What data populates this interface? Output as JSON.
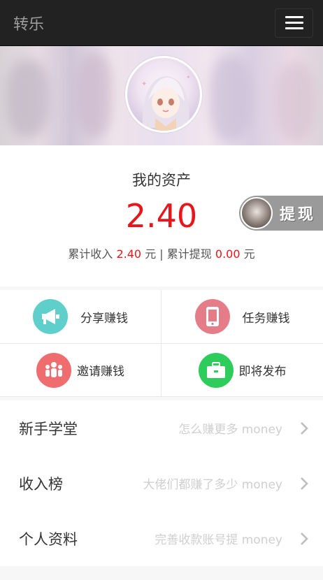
{
  "header": {
    "brand": "转乐",
    "menu_icon": "hamburger-icon"
  },
  "banner": {
    "avatar_icon": "anime-avatar"
  },
  "assets": {
    "title": "我的资产",
    "amount": "2.40",
    "income_label": "累计收入",
    "income_value": "2.40",
    "unit1": "元",
    "separator": "|",
    "withdrawn_label": "累计提现",
    "withdrawn_value": "0.00",
    "unit2": "元"
  },
  "withdraw_button": {
    "label": "提现",
    "avatar_icon": "anime-avatar-small"
  },
  "actions": [
    {
      "label": "分享赚钱",
      "icon": "megaphone-icon",
      "color": "#5fcfcb"
    },
    {
      "label": "任务赚钱",
      "icon": "phone-icon",
      "color": "#e47d87"
    },
    {
      "label": "邀请赚钱",
      "icon": "people-icon",
      "color": "#ef6d6e"
    },
    {
      "label": "即将发布",
      "icon": "briefcase-icon",
      "color": "#2ecc5a"
    }
  ],
  "menu": [
    {
      "label": "新手学堂",
      "hint": "怎么赚更多 money"
    },
    {
      "label": "收入榜",
      "hint": "大佬们都赚了多少 money"
    },
    {
      "label": "个人资料",
      "hint": "完善收款账号提 money"
    }
  ],
  "colors": {
    "accent_red": "#e8161a",
    "navbar": "#222222"
  }
}
